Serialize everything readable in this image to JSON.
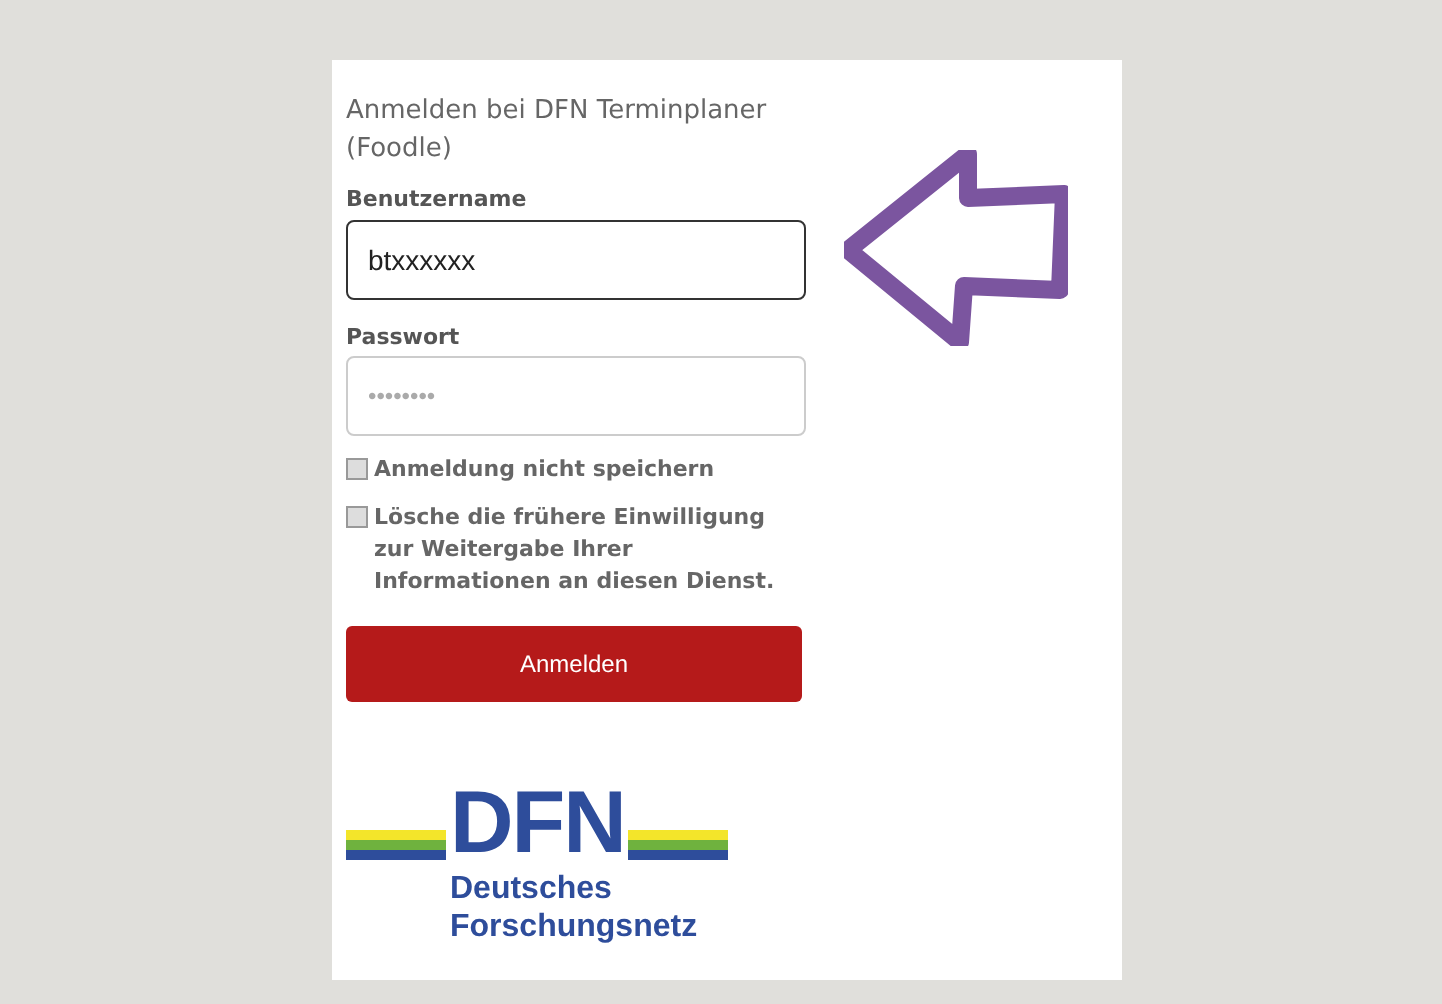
{
  "login": {
    "title": "Anmelden bei DFN Terminplaner (Foodle)",
    "username": {
      "label": "Benutzername",
      "value": "btxxxxxx"
    },
    "password": {
      "label": "Passwort",
      "value": "••••••••"
    },
    "options": [
      {
        "label": "Anmeldung nicht speichern",
        "checked": false
      },
      {
        "label": "Lösche die frühere Einwilligung zur Weitergabe Ihrer Informationen an diesen Dienst.",
        "checked": false
      }
    ],
    "submit": "Anmelden"
  },
  "logo": {
    "name": "DFN",
    "subtitle": [
      "Deutsches",
      "Forschungsnetz"
    ]
  }
}
